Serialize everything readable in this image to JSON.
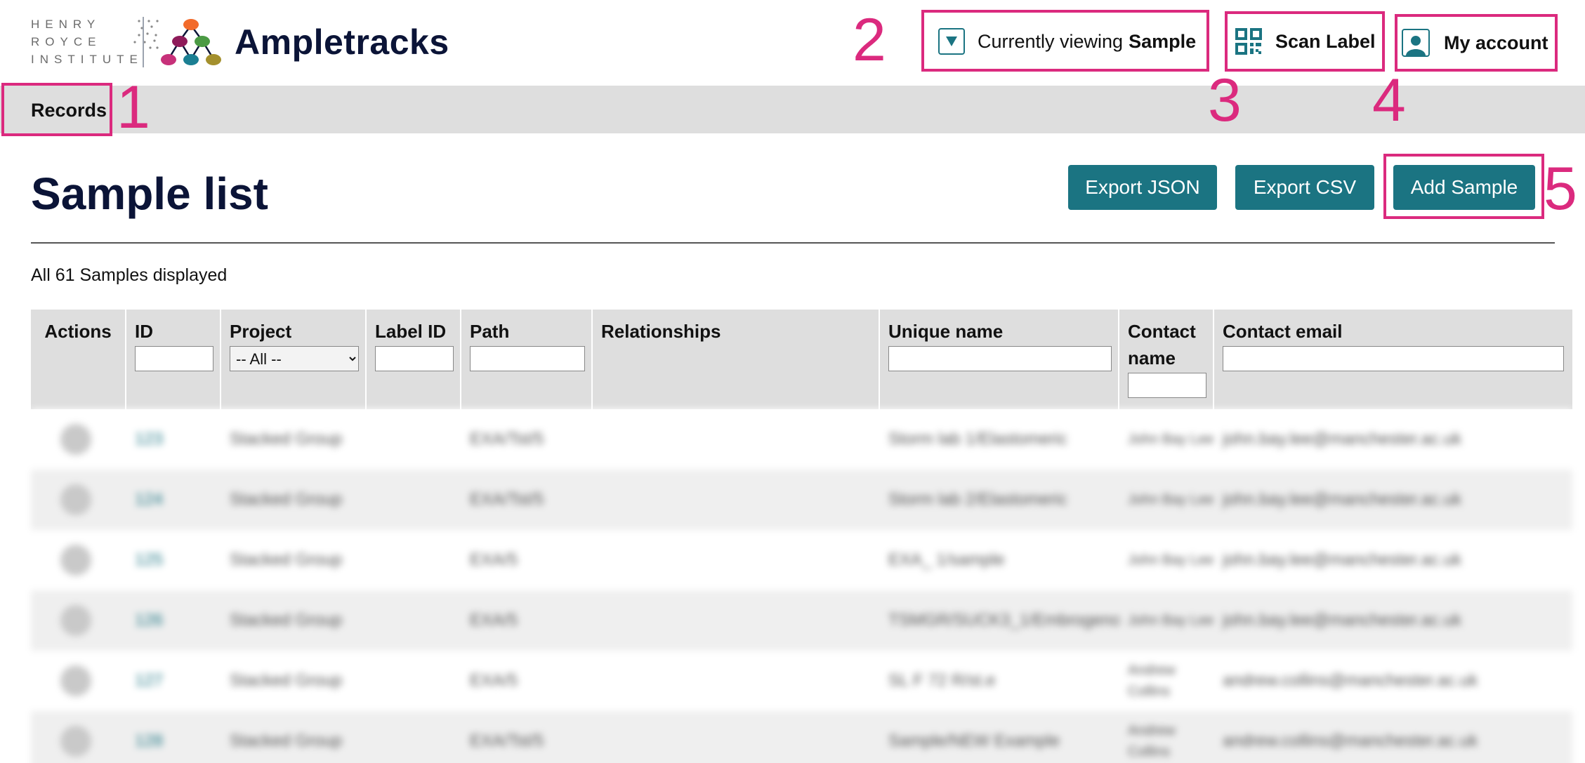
{
  "header": {
    "institute_lines": [
      "HENRY",
      "ROYCE",
      "INSTITUTE"
    ],
    "app_title": "Ampletracks",
    "viewing_prefix": "Currently viewing",
    "viewing_type": "Sample",
    "scan_label": "Scan Label",
    "account_label": "My account"
  },
  "nav": {
    "records": "Records"
  },
  "annotations": [
    "1",
    "2",
    "3",
    "4",
    "5"
  ],
  "page": {
    "title": "Sample list",
    "export_json": "Export JSON",
    "export_csv": "Export CSV",
    "add_sample": "Add Sample",
    "count_text": "All 61 Samples displayed"
  },
  "table": {
    "columns": {
      "actions": "Actions",
      "id": "ID",
      "project": "Project",
      "label_id": "Label ID",
      "path": "Path",
      "relationships": "Relationships",
      "unique_name": "Unique name",
      "contact_name_1": "Contact",
      "contact_name_2": "name",
      "contact_email": "Contact email"
    },
    "project_filter_selected": "-- All --",
    "rows": [
      {
        "id": "123",
        "project": "Stacked Group",
        "path": "EXA/Tst/5",
        "unique_name": "Storm lab 1/Elastomeric",
        "contact_name": "John Bay Lee",
        "contact_email": "john.bay.lee@manchester.ac.uk"
      },
      {
        "id": "124",
        "project": "Stacked Group",
        "path": "EXA/Tst/5",
        "unique_name": "Storm lab 2/Elastomeric",
        "contact_name": "John Bay Lee",
        "contact_email": "john.bay.lee@manchester.ac.uk"
      },
      {
        "id": "125",
        "project": "Stacked Group",
        "path": "EXA/5",
        "unique_name": "EXA_ 1/sample",
        "contact_name": "John Bay Lee",
        "contact_email": "john.bay.lee@manchester.ac.uk"
      },
      {
        "id": "126",
        "project": "Stacked Group",
        "path": "EXA/5",
        "unique_name": "TSMGR/SUCK3_1/Embrogenous",
        "contact_name": "John Bay Lee",
        "contact_email": "john.bay.lee@manchester.ac.uk"
      },
      {
        "id": "127",
        "project": "Stacked Group",
        "path": "EXA/5",
        "unique_name": "SL F 72 R/st.e",
        "contact_name": "Andrew Collins",
        "contact_email": "andrew.collins@manchester.ac.uk"
      },
      {
        "id": "128",
        "project": "Stacked Group",
        "path": "EXA/Tst/5",
        "unique_name": "Sample/NEW Example",
        "contact_name": "Andrew Collins",
        "contact_email": "andrew.collins@manchester.ac.uk"
      }
    ]
  }
}
